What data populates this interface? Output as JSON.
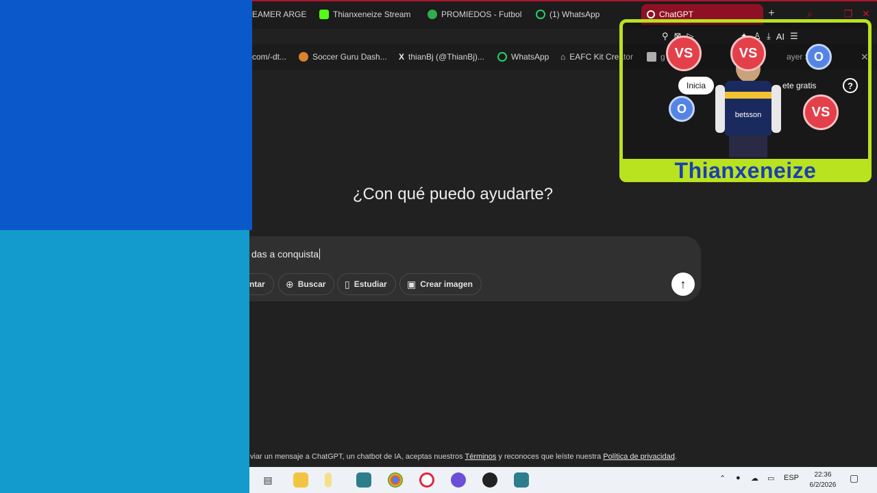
{
  "tabs": [
    {
      "label": "EAMER ARGEN",
      "icon": "tab-icon"
    },
    {
      "label": "Thianxeneize Stream",
      "icon": "kick-icon"
    },
    {
      "label": "PROMIEDOS - Futbol",
      "icon": "soccer-ball-icon"
    },
    {
      "label": "(1) WhatsApp",
      "icon": "whatsapp-icon"
    }
  ],
  "active_tab": {
    "label": "ChatGPT",
    "icon": "chatgpt-icon"
  },
  "bookmarks": [
    {
      "label": "com/-dt...",
      "icon": ""
    },
    {
      "label": "Soccer Guru Dash...",
      "icon": "soccer-guru-icon"
    },
    {
      "label": "thianBj (@ThianBj)...",
      "icon": "x-icon"
    },
    {
      "label": "WhatsApp",
      "icon": "whatsapp-icon"
    },
    {
      "label": "EAFC Kit Creator",
      "icon": "shirt-icon"
    },
    {
      "label": "g",
      "icon": "doc-icon"
    },
    {
      "label": "ayer Searc",
      "icon": ""
    }
  ],
  "toolbar": {
    "ai_label": "AI"
  },
  "main": {
    "greeting": "¿Con qué puedo ayudarte?",
    "composer_text": "das a conquista",
    "tools": [
      {
        "label": "ntar",
        "icon": ""
      },
      {
        "label": "Buscar",
        "icon": "globe-icon"
      },
      {
        "label": "Estudiar",
        "icon": "book-icon"
      },
      {
        "label": "Crear imagen",
        "icon": "image-icon"
      }
    ],
    "legal": {
      "prefix": "viar un mensaje a ChatGPT, un chatbot de IA, aceptas nuestros ",
      "terms": "Términos",
      "middle": " y reconoces que leíste nuestra ",
      "privacy": "Política de privacidad",
      "suffix": "."
    }
  },
  "header_buttons": {
    "login": "Inicia",
    "signup": "ete gratis"
  },
  "overlay": {
    "name": "Thianxeneize",
    "vs_label": "VS",
    "o_label": "O",
    "shirt_sponsor": "betsson"
  },
  "taskbar": {
    "language": "ESP",
    "time": "22:36",
    "date": "6/2/2026"
  },
  "colors": {
    "blue_top": "#0a58c9",
    "blue_bottom": "#129bcc",
    "chat_bg": "#212121",
    "active_tab": "#8e1024",
    "overlay_green": "#b9e21f",
    "overlay_text": "#1a3fb0"
  }
}
